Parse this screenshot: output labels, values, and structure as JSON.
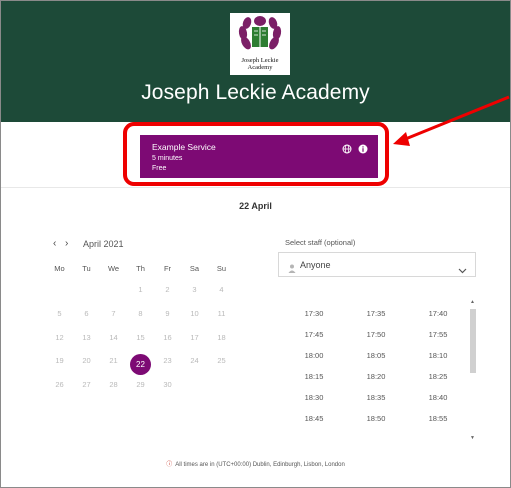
{
  "header": {
    "school_name": "Joseph Leckie Academy",
    "logo_text_line1": "Joseph Leckie",
    "logo_text_line2": "Academy"
  },
  "service": {
    "name": "Example Service",
    "duration": "5 minutes",
    "price": "Free",
    "icons": [
      "globe-icon",
      "info-icon"
    ]
  },
  "selected_date_heading": "22 April",
  "calendar": {
    "month_label": "April 2021",
    "weekdays": [
      "Mo",
      "Tu",
      "We",
      "Th",
      "Fr",
      "Sa",
      "Su"
    ],
    "weeks": [
      [
        "",
        "",
        "",
        "1",
        "2",
        "3",
        "4"
      ],
      [
        "5",
        "6",
        "7",
        "8",
        "9",
        "10",
        "11"
      ],
      [
        "12",
        "13",
        "14",
        "15",
        "16",
        "17",
        "18"
      ],
      [
        "19",
        "20",
        "21",
        "22",
        "23",
        "24",
        "25"
      ],
      [
        "26",
        "27",
        "28",
        "29",
        "30",
        "",
        ""
      ]
    ],
    "selected_day": "22"
  },
  "staff": {
    "label": "Select staff (optional)",
    "value": "Anyone"
  },
  "times": [
    [
      "17:30",
      "17:35",
      "17:40"
    ],
    [
      "17:45",
      "17:50",
      "17:55"
    ],
    [
      "18:00",
      "18:05",
      "18:10"
    ],
    [
      "18:15",
      "18:20",
      "18:25"
    ],
    [
      "18:30",
      "18:35",
      "18:40"
    ],
    [
      "18:45",
      "18:50",
      "18:55"
    ]
  ],
  "timezone_note": "All times are in (UTC+00:00) Dublin, Edinburgh, Lisbon, London",
  "colors": {
    "header_bg": "#1d4a38",
    "accent": "#7d0a74",
    "annotation": "#ee0000"
  }
}
